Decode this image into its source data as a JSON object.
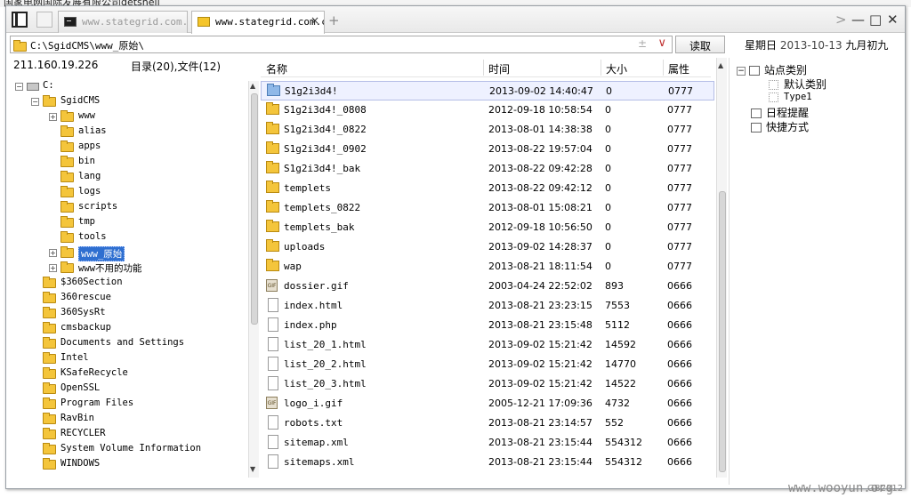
{
  "background": {
    "top_text": "国家电网国际发展有限公司getshell"
  },
  "tabs": [
    {
      "label": "www.stategrid.com.cn",
      "active": false
    },
    {
      "label": "www.stategrid.com.cn",
      "active": true
    }
  ],
  "tab_close_glyph": "×",
  "tab_add_glyph": "+",
  "window_controls": {
    "arrow": ">",
    "minimize": "—",
    "maximize": "□",
    "close": "✕"
  },
  "address": {
    "path": "C:\\SgidCMS\\www_原始\\",
    "plusminus": "±",
    "dropdown": "∨"
  },
  "read_button": "读取",
  "date": {
    "weekday": "星期日",
    "date": "2013-10-13",
    "lunar": "九月初九"
  },
  "left_panel": {
    "ip": "211.160.19.226",
    "counts": "目录(20),文件(12)"
  },
  "tree": [
    {
      "label": "C:",
      "level": 0,
      "exp": "−",
      "type": "drive"
    },
    {
      "label": "SgidCMS",
      "level": 1,
      "exp": "−",
      "type": "folder"
    },
    {
      "label": "www",
      "level": 2,
      "exp": "+",
      "type": "folder"
    },
    {
      "label": "alias",
      "level": 2,
      "exp": "",
      "type": "folder"
    },
    {
      "label": "apps",
      "level": 2,
      "exp": "",
      "type": "folder"
    },
    {
      "label": "bin",
      "level": 2,
      "exp": "",
      "type": "folder"
    },
    {
      "label": "lang",
      "level": 2,
      "exp": "",
      "type": "folder"
    },
    {
      "label": "logs",
      "level": 2,
      "exp": "",
      "type": "folder"
    },
    {
      "label": "scripts",
      "level": 2,
      "exp": "",
      "type": "folder"
    },
    {
      "label": "tmp",
      "level": 2,
      "exp": "",
      "type": "folder"
    },
    {
      "label": "tools",
      "level": 2,
      "exp": "",
      "type": "folder"
    },
    {
      "label": "www_原始",
      "level": 2,
      "exp": "+",
      "type": "folder",
      "selected": true
    },
    {
      "label": "www不用的功能",
      "level": 2,
      "exp": "+",
      "type": "folder"
    },
    {
      "label": "$360Section",
      "level": 1,
      "exp": "",
      "type": "folder"
    },
    {
      "label": "360rescue",
      "level": 1,
      "exp": "",
      "type": "folder"
    },
    {
      "label": "360SysRt",
      "level": 1,
      "exp": "",
      "type": "folder"
    },
    {
      "label": "cmsbackup",
      "level": 1,
      "exp": "",
      "type": "folder"
    },
    {
      "label": "Documents and Settings",
      "level": 1,
      "exp": "",
      "type": "folder"
    },
    {
      "label": "Intel",
      "level": 1,
      "exp": "",
      "type": "folder"
    },
    {
      "label": "KSafeRecycle",
      "level": 1,
      "exp": "",
      "type": "folder"
    },
    {
      "label": "OpenSSL",
      "level": 1,
      "exp": "",
      "type": "folder"
    },
    {
      "label": "Program Files",
      "level": 1,
      "exp": "",
      "type": "folder"
    },
    {
      "label": "RavBin",
      "level": 1,
      "exp": "",
      "type": "folder"
    },
    {
      "label": "RECYCLER",
      "level": 1,
      "exp": "",
      "type": "folder"
    },
    {
      "label": "System Volume Information",
      "level": 1,
      "exp": "",
      "type": "folder"
    },
    {
      "label": "WINDOWS",
      "level": 1,
      "exp": "",
      "type": "folder"
    }
  ],
  "columns": {
    "name": "名称",
    "time": "时间",
    "size": "大小",
    "attr": "属性"
  },
  "files": [
    {
      "name": "S1g2i3d4!",
      "time": "2013-09-02 14:40:47",
      "size": "0",
      "attr": "0777",
      "type": "folder-blue",
      "selected": true
    },
    {
      "name": "S1g2i3d4!_0808",
      "time": "2012-09-18 10:58:54",
      "size": "0",
      "attr": "0777",
      "type": "folder"
    },
    {
      "name": "S1g2i3d4!_0822",
      "time": "2013-08-01 14:38:38",
      "size": "0",
      "attr": "0777",
      "type": "folder"
    },
    {
      "name": "S1g2i3d4!_0902",
      "time": "2013-08-22 19:57:04",
      "size": "0",
      "attr": "0777",
      "type": "folder"
    },
    {
      "name": "S1g2i3d4!_bak",
      "time": "2013-08-22 09:42:28",
      "size": "0",
      "attr": "0777",
      "type": "folder"
    },
    {
      "name": "templets",
      "time": "2013-08-22 09:42:12",
      "size": "0",
      "attr": "0777",
      "type": "folder"
    },
    {
      "name": "templets_0822",
      "time": "2013-08-01 15:08:21",
      "size": "0",
      "attr": "0777",
      "type": "folder"
    },
    {
      "name": "templets_bak",
      "time": "2012-09-18 10:56:50",
      "size": "0",
      "attr": "0777",
      "type": "folder"
    },
    {
      "name": "uploads",
      "time": "2013-09-02 14:28:37",
      "size": "0",
      "attr": "0777",
      "type": "folder"
    },
    {
      "name": "wap",
      "time": "2013-08-21 18:11:54",
      "size": "0",
      "attr": "0777",
      "type": "folder"
    },
    {
      "name": "dossier.gif",
      "time": "2003-04-24 22:52:02",
      "size": "893",
      "attr": "0666",
      "type": "gif"
    },
    {
      "name": "index.html",
      "time": "2013-08-21 23:23:15",
      "size": "7553",
      "attr": "0666",
      "type": "file"
    },
    {
      "name": "index.php",
      "time": "2013-08-21 23:15:48",
      "size": "5112",
      "attr": "0666",
      "type": "file"
    },
    {
      "name": "list_20_1.html",
      "time": "2013-09-02 15:21:42",
      "size": "14592",
      "attr": "0666",
      "type": "file"
    },
    {
      "name": "list_20_2.html",
      "time": "2013-09-02 15:21:42",
      "size": "14770",
      "attr": "0666",
      "type": "file"
    },
    {
      "name": "list_20_3.html",
      "time": "2013-09-02 15:21:42",
      "size": "14522",
      "attr": "0666",
      "type": "file"
    },
    {
      "name": "logo_i.gif",
      "time": "2005-12-21 17:09:36",
      "size": "4732",
      "attr": "0666",
      "type": "gif"
    },
    {
      "name": "robots.txt",
      "time": "2013-08-21 23:14:57",
      "size": "552",
      "attr": "0666",
      "type": "file"
    },
    {
      "name": "sitemap.xml",
      "time": "2013-08-21 23:15:44",
      "size": "554312",
      "attr": "0666",
      "type": "file"
    },
    {
      "name": "sitemaps.xml",
      "time": "2013-08-21 23:15:44",
      "size": "554312",
      "attr": "0666",
      "type": "file"
    }
  ],
  "right_panel": {
    "site_category": "站点类别",
    "default_category": "默认类别",
    "type1": "Type1",
    "schedule": "日程提醒",
    "shortcut": "快捷方式"
  },
  "footer_code": "GB2312",
  "watermark": "www.wooyun.org",
  "icon_names": [
    "panel-toggle-icon",
    "terminal-icon",
    "folder-icon",
    "file-icon",
    "gif-icon",
    "drive-icon"
  ],
  "colors": {
    "selected_tree": "#2f6fd0",
    "selected_row": "#eef1ff",
    "folder": "#f4c53b",
    "dropdown_accent": "#c03030"
  }
}
